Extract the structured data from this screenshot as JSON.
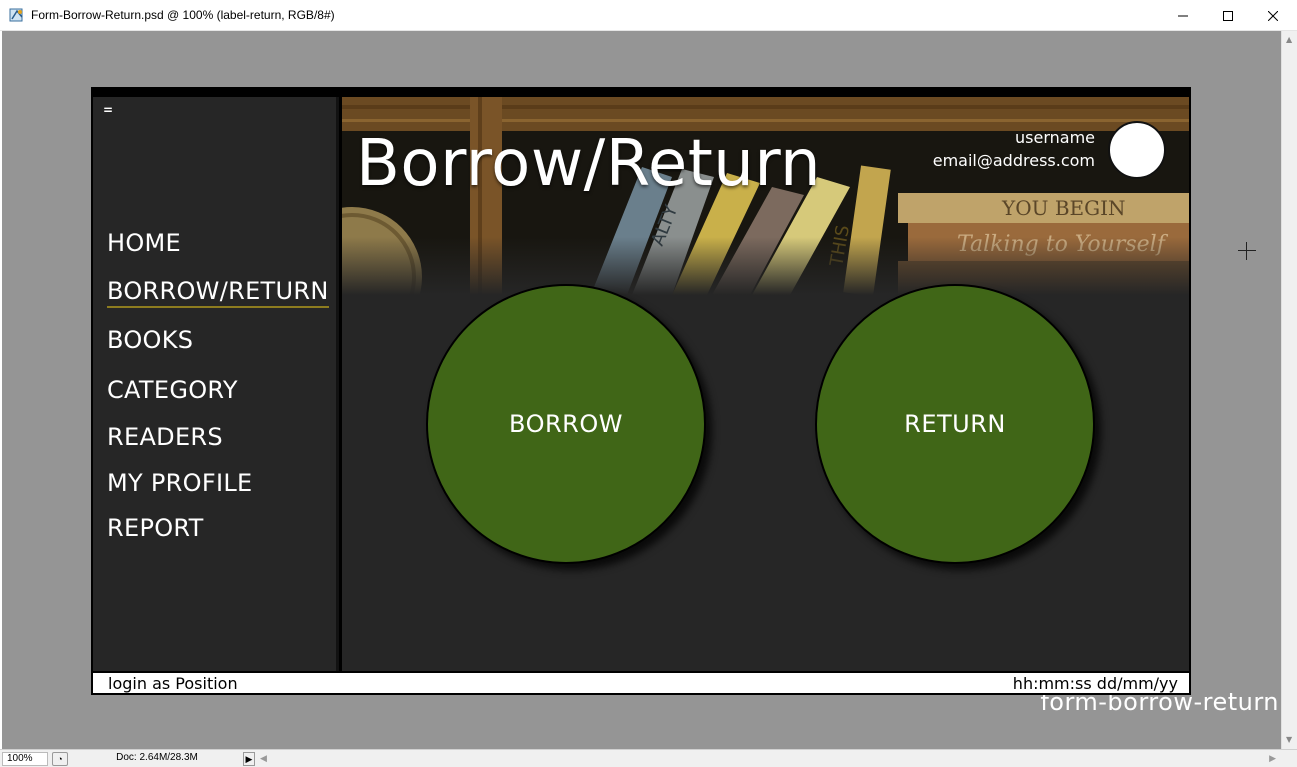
{
  "window": {
    "title": "Form-Borrow-Return.psd @ 100% (label-return, RGB/8#)",
    "minimize": "—",
    "maximize": "☐",
    "close": "✕"
  },
  "app": {
    "menu_toggle": "=",
    "page_title": "Borrow/Return",
    "user": {
      "name": "username",
      "email": "email@address.com"
    },
    "nav": [
      {
        "label": "HOME"
      },
      {
        "label": "BORROW/RETURN"
      },
      {
        "label": "BOOKS"
      },
      {
        "label": "CATEGORY"
      },
      {
        "label": "READERS"
      },
      {
        "label": "MY PROFILE"
      },
      {
        "label": "REPORT"
      }
    ],
    "actions": {
      "borrow": "BORROW",
      "return": "RETURN"
    },
    "status": {
      "login": "login as Position",
      "datetime": "hh:mm:ss dd/mm/yy"
    },
    "banner_books": {
      "spine_1": "ALTY",
      "spine_2": "THIS",
      "book_1": "YOU BEGIN",
      "book_2": "Talking to Yourself"
    }
  },
  "overlay_label": "form-borrow-return",
  "ps_status": {
    "zoom": "100%",
    "doc": "Doc: 2.64M/28.3M"
  },
  "colors": {
    "button_green": "#406617",
    "panel_dark": "#262626",
    "active_underline": "#8d7c1f",
    "canvas_gray": "#959595"
  }
}
